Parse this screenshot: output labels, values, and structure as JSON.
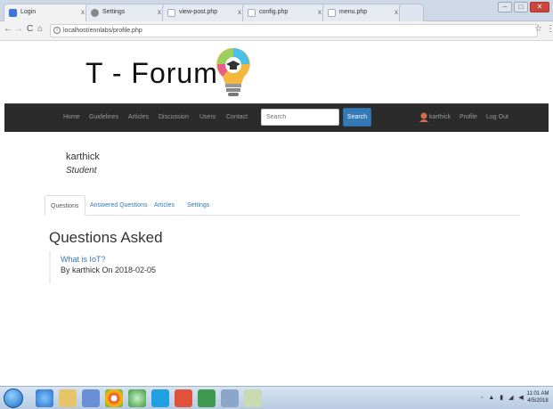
{
  "browser": {
    "tabs": [
      {
        "label": "Login",
        "color": "#3b78d8"
      },
      {
        "label": "Settings",
        "color": "#888888"
      },
      {
        "label": "view-post.php",
        "color": "#aaaaaa"
      },
      {
        "label": "config.php",
        "color": "#aaaaaa"
      },
      {
        "label": "menu.php",
        "color": "#aaaaaa"
      }
    ],
    "close_glyph": "x",
    "url": "localhost/ennlabs/profile.php",
    "info_glyph": "i",
    "star_glyph": "☆",
    "nav_back": "←",
    "nav_forward": "→",
    "nav_reload": "C",
    "nav_home": "⌂",
    "menu_glyph": "⋮"
  },
  "site": {
    "title": "T  -  Forum",
    "nav": {
      "items": [
        "Home",
        "Guidelines",
        "Articles",
        "Discussion",
        "Users",
        "Contact"
      ],
      "search_placeholder": "Search",
      "search_button": "Search",
      "username": "karthick",
      "profile": "Profile",
      "logout": "Log Out"
    }
  },
  "profile": {
    "name": "karthick",
    "role": "Student",
    "tabs": [
      "Questions",
      "Answered Questions",
      "Articles",
      "Settings"
    ],
    "active_tab": "Questions",
    "section_title": "Questions Asked",
    "questions": [
      {
        "title": "What is IoT?",
        "meta": "By karthick On 2018-02-05"
      }
    ]
  },
  "taskbar": {
    "tray_text": "◦ ▲ ▮ ◢ ◀",
    "time": "11:01 AM",
    "date": "4/5/2018"
  },
  "colors": {
    "navbar_bg": "#2b2b2b",
    "link": "#337ab7",
    "search_button": "#337ab7"
  }
}
